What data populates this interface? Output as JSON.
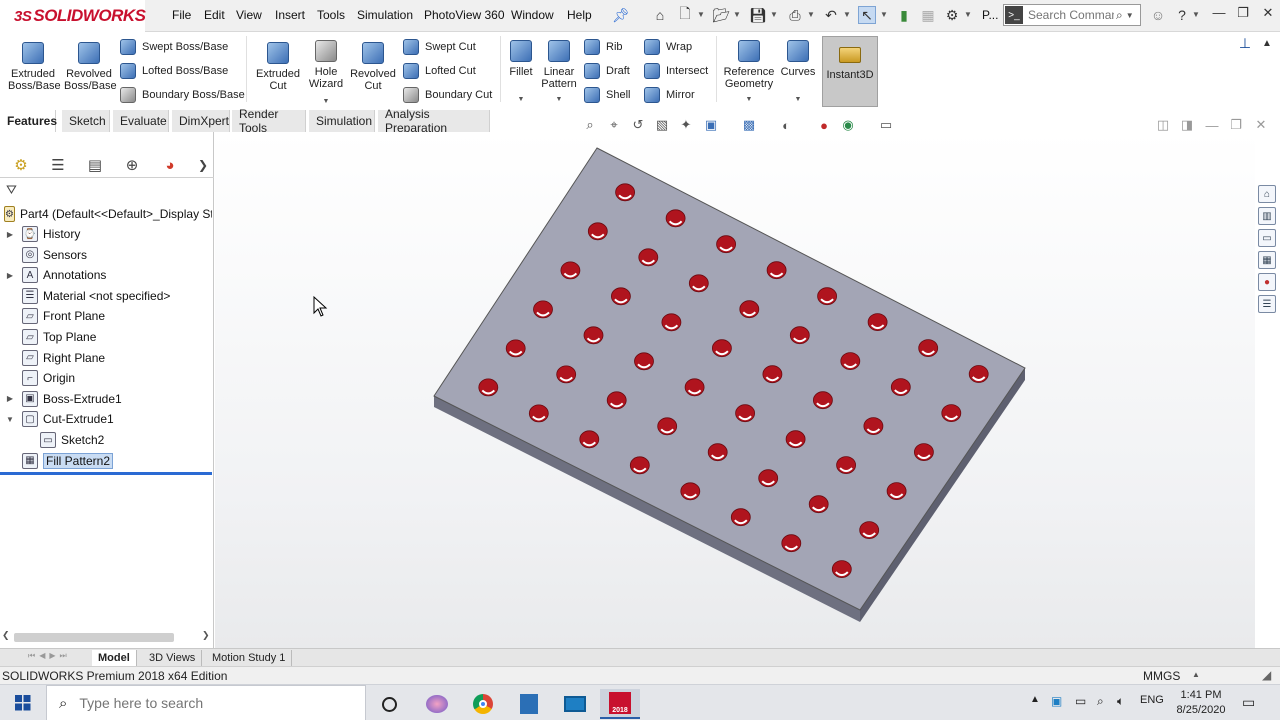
{
  "app": {
    "brand": "SOLIDWORKS",
    "brand_prefix": "3S",
    "menu": [
      "File",
      "Edit",
      "View",
      "Insert",
      "Tools",
      "Simulation",
      "PhotoView 360",
      "Window",
      "Help"
    ],
    "toolbar_truncated_label": "P...",
    "search": {
      "placeholder": "Search Commands"
    }
  },
  "ribbon": {
    "extruded_boss": "Extruded Boss/Base",
    "revolved_boss": "Revolved Boss/Base",
    "swept_boss": "Swept Boss/Base",
    "lofted_boss": "Lofted Boss/Base",
    "boundary_boss": "Boundary Boss/Base",
    "extruded_cut": "Extruded Cut",
    "hole_wizard": "Hole Wizard",
    "revolved_cut": "Revolved Cut",
    "swept_cut": "Swept Cut",
    "lofted_cut": "Lofted Cut",
    "boundary_cut": "Boundary Cut",
    "fillet": "Fillet",
    "linear_pattern": "Linear Pattern",
    "rib": "Rib",
    "draft": "Draft",
    "shell": "Shell",
    "wrap": "Wrap",
    "intersect": "Intersect",
    "mirror": "Mirror",
    "reference_geometry": "Reference Geometry",
    "curves": "Curves",
    "instant3d": "Instant3D"
  },
  "tabs": [
    "Features",
    "Sketch",
    "Evaluate",
    "DimXpert",
    "Render Tools",
    "Simulation",
    "Analysis Preparation"
  ],
  "tree": {
    "root": "Part4  (Default<<Default>_Display Sta",
    "items": [
      {
        "label": "History",
        "icon": "history-icon",
        "expandable": true
      },
      {
        "label": "Sensors",
        "icon": "sensors-icon",
        "expandable": false
      },
      {
        "label": "Annotations",
        "icon": "annotations-icon",
        "expandable": true
      },
      {
        "label": "Material <not specified>",
        "icon": "material-icon",
        "expandable": false
      },
      {
        "label": "Front Plane",
        "icon": "plane-icon",
        "expandable": false
      },
      {
        "label": "Top Plane",
        "icon": "plane-icon",
        "expandable": false
      },
      {
        "label": "Right Plane",
        "icon": "plane-icon",
        "expandable": false
      },
      {
        "label": "Origin",
        "icon": "origin-icon",
        "expandable": false
      },
      {
        "label": "Boss-Extrude1",
        "icon": "boss-extrude-icon",
        "expandable": true
      },
      {
        "label": "Cut-Extrude1",
        "icon": "cut-extrude-icon",
        "expandable": true,
        "expanded": true
      },
      {
        "label": "Sketch2",
        "icon": "sketch-icon",
        "expandable": false,
        "child": true
      },
      {
        "label": "Fill Pattern2",
        "icon": "fill-pattern-icon",
        "expandable": false,
        "selected": true
      }
    ]
  },
  "bottom_tabs": [
    "Model",
    "3D Views",
    "Motion Study 1"
  ],
  "status": {
    "edition": "SOLIDWORKS Premium 2018 x64 Edition",
    "units": "MMGS"
  },
  "taskbar": {
    "search_placeholder": "Type here to search",
    "language": "ENG",
    "time": "1:41 PM",
    "date": "8/25/2020",
    "sw_badge": "2018"
  },
  "colors": {
    "plate_top": "#a3a5b5",
    "plate_side": "#6e7080",
    "hole": "#b0141e",
    "selection": "#c9dcf3",
    "brand": "#c8102e"
  }
}
